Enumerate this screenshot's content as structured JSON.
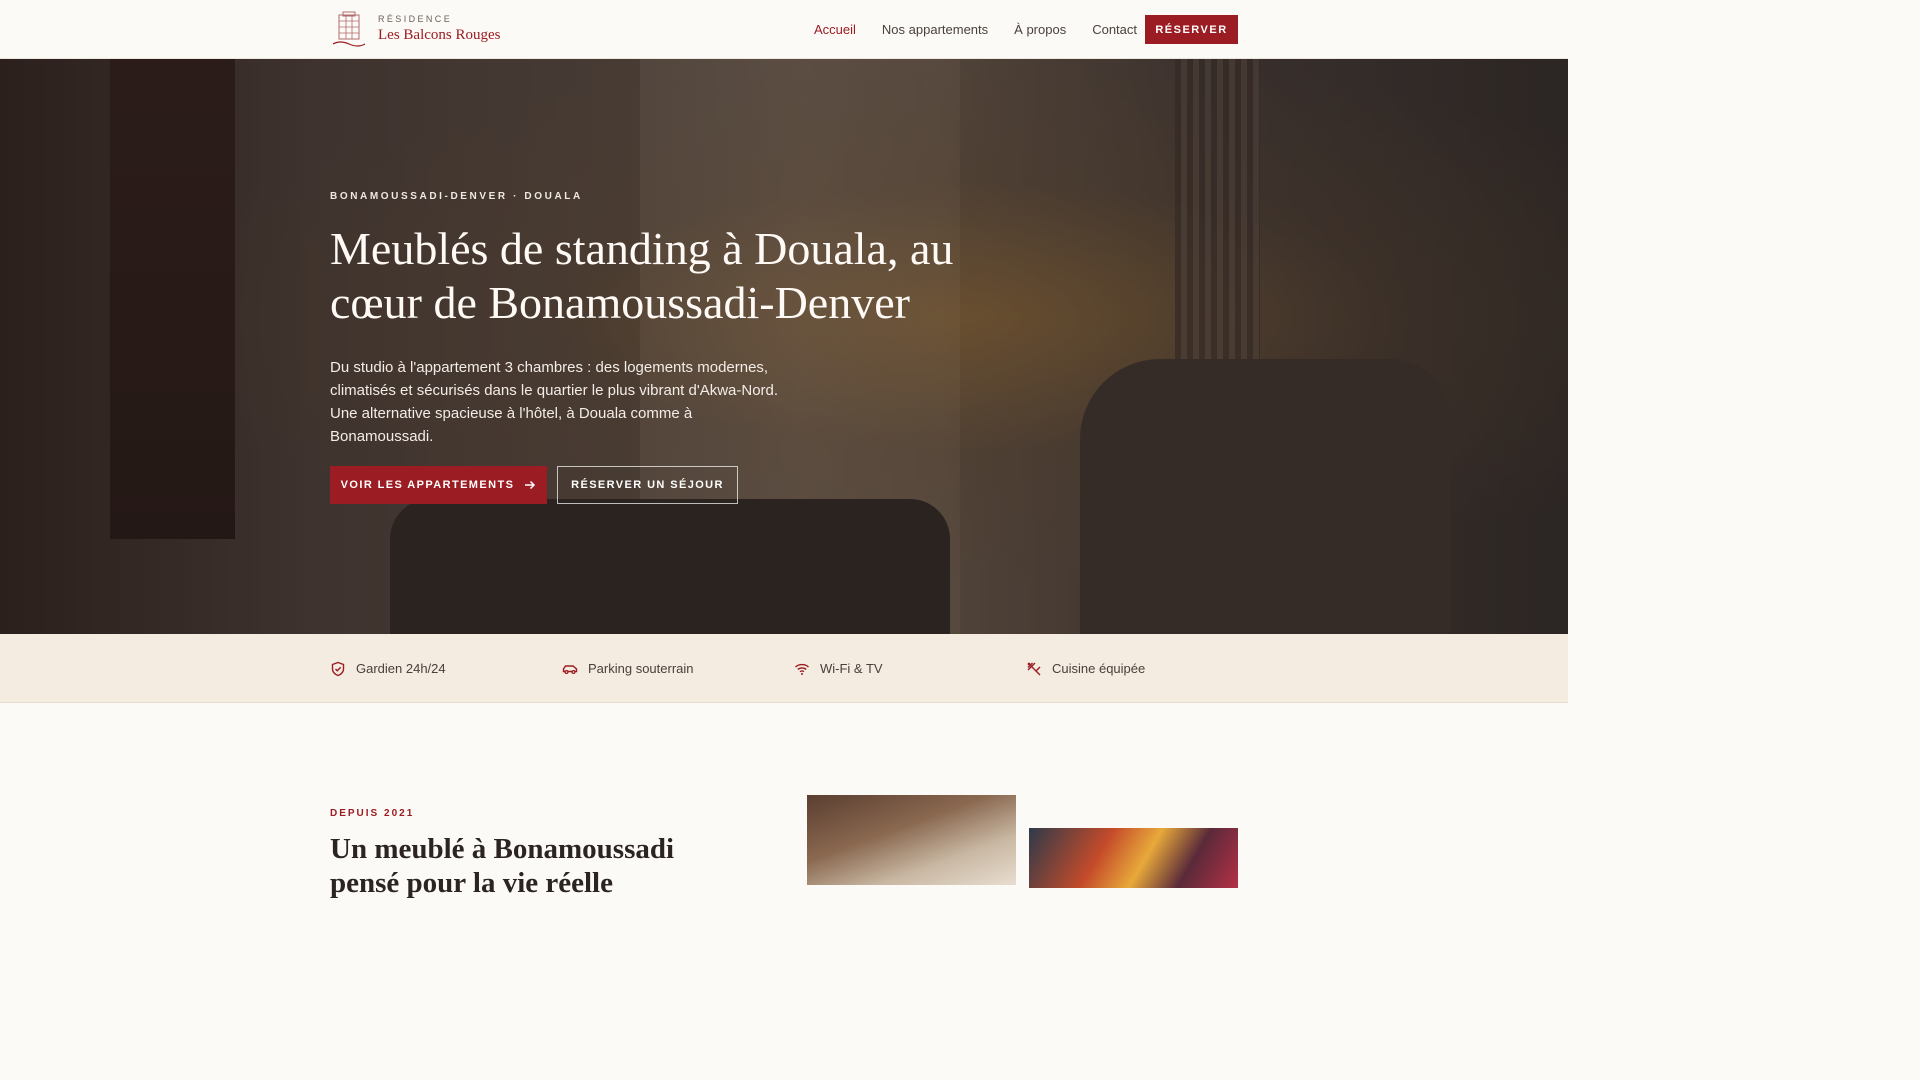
{
  "header": {
    "logo_eyebrow": "RÉSIDENCE",
    "logo_name": "Les Balcons Rouges",
    "nav": [
      {
        "label": "Accueil",
        "active": true
      },
      {
        "label": "Nos appartements",
        "active": false
      },
      {
        "label": "À propos",
        "active": false
      },
      {
        "label": "Contact",
        "active": false
      }
    ],
    "cta_label": "RÉSERVER"
  },
  "hero": {
    "eyebrow": "BONAMOUSSADI-DENVER · DOUALA",
    "title": "Meublés de standing à Douala, au cœur de Bonamoussadi-Denver",
    "subtitle": "Du studio à l'appartement 3 chambres : des logements modernes, climatisés et sécurisés dans le quartier le plus vibrant d'Akwa-Nord. Une alternative spacieuse à l'hôtel, à Douala comme à Bonamoussadi.",
    "primary_label": "VOIR LES APPARTEMENTS",
    "secondary_label": "RÉSERVER UN SÉJOUR"
  },
  "features": [
    {
      "icon": "shield-icon",
      "label": "Gardien 24h/24"
    },
    {
      "icon": "car-icon",
      "label": "Parking souterrain"
    },
    {
      "icon": "wifi-icon",
      "label": "Wi-Fi & TV"
    },
    {
      "icon": "utensils-icon",
      "label": "Cuisine équipée"
    }
  ],
  "about": {
    "eyebrow": "DEPUIS 2021",
    "title": "Un meublé à Bonamoussadi pensé pour la vie réelle"
  },
  "colors": {
    "accent": "#9b1c22",
    "background": "#fcfaf6",
    "features_bg": "#f4ece0"
  }
}
